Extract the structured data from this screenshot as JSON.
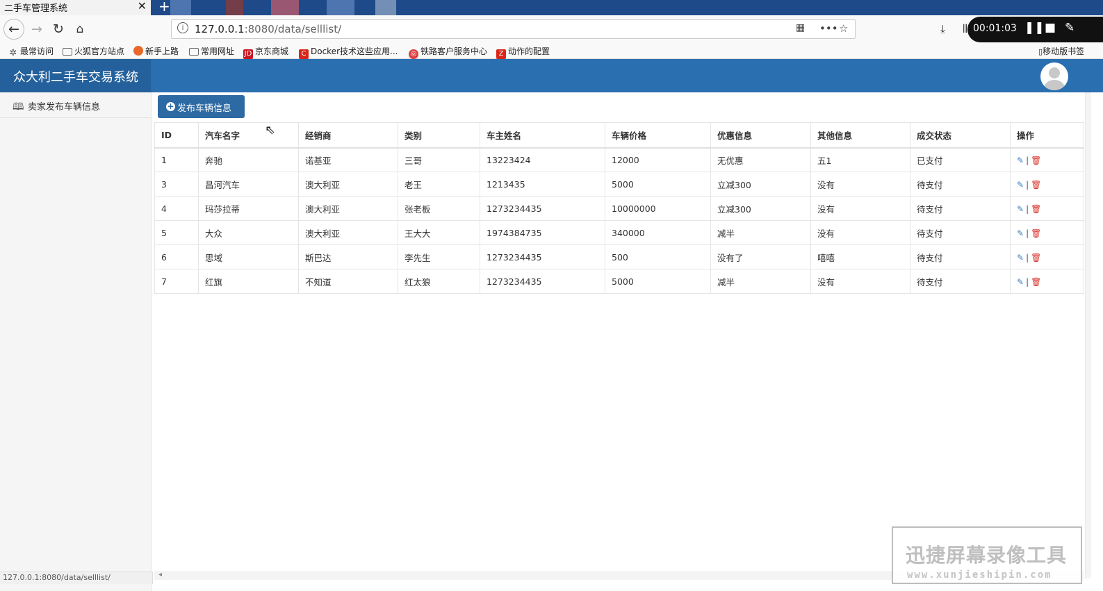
{
  "browser": {
    "tab_title": "二手车管理系统",
    "tab_close": "✕",
    "new_tab": "+",
    "url_host": "127.0.0.1",
    "url_rest": ":8080/data/selllist/",
    "status_url": "127.0.0.1:8080/data/selllist/",
    "recording_time": "00:01:03",
    "bookmarks": [
      {
        "label": "最常访问",
        "icon": "gear-icon"
      },
      {
        "label": "火狐官方站点",
        "icon": "folder-icon"
      },
      {
        "label": "新手上路",
        "icon": "firefox-icon"
      },
      {
        "label": "常用网址",
        "icon": "folder-icon"
      },
      {
        "label": "京东商城",
        "icon": "jd-icon"
      },
      {
        "label": "Docker技术这些应用...",
        "icon": "c-icon"
      },
      {
        "label": "铁路客户服务中心",
        "icon": "rail-icon"
      },
      {
        "label": "动作的配置",
        "icon": "z-icon"
      }
    ],
    "mobile_bookmarks": "移动版书签",
    "colors": {
      "brand": "#2a6fb0",
      "tabbar": "#1e4a8a"
    }
  },
  "app": {
    "title": "众大利二手车交易系统"
  },
  "sidebar": {
    "items": [
      {
        "label": "卖家发布车辆信息",
        "icon": "book-icon"
      }
    ]
  },
  "main": {
    "publish_button": "发布车辆信息",
    "columns": [
      "ID",
      "汽车名字",
      "经销商",
      "类别",
      "车主姓名",
      "车辆价格",
      "优惠信息",
      "其他信息",
      "成交状态",
      "操作"
    ],
    "rows": [
      {
        "id": "1",
        "name": "奔驰",
        "dealer": "诺基亚",
        "category": "三哥",
        "owner": "13223424",
        "price": "12000",
        "discount": "无优惠",
        "other": "五1",
        "status": "已支付"
      },
      {
        "id": "3",
        "name": "昌河汽车",
        "dealer": "澳大利亚",
        "category": "老王",
        "owner": "1213435",
        "price": "5000",
        "discount": "立减300",
        "other": "没有",
        "status": "待支付"
      },
      {
        "id": "4",
        "name": "玛莎拉蒂",
        "dealer": "澳大利亚",
        "category": "张老板",
        "owner": "1273234435",
        "price": "10000000",
        "discount": "立减300",
        "other": "没有",
        "status": "待支付"
      },
      {
        "id": "5",
        "name": "大众",
        "dealer": "澳大利亚",
        "category": "王大大",
        "owner": "1974384735",
        "price": "340000",
        "discount": "减半",
        "other": "没有",
        "status": "待支付"
      },
      {
        "id": "6",
        "name": "思域",
        "dealer": "斯巴达",
        "category": "李先生",
        "owner": "1273234435",
        "price": "500",
        "discount": "没有了",
        "other": "嘻嘻",
        "status": "待支付"
      },
      {
        "id": "7",
        "name": "红旗",
        "dealer": "不知道",
        "category": "红太狼",
        "owner": "1273234435",
        "price": "5000",
        "discount": "减半",
        "other": "没有",
        "status": "待支付"
      }
    ],
    "action_separator": "|"
  },
  "watermark": {
    "title": "迅捷屏幕录像工具",
    "url": "www.xunjieshipin.com"
  }
}
